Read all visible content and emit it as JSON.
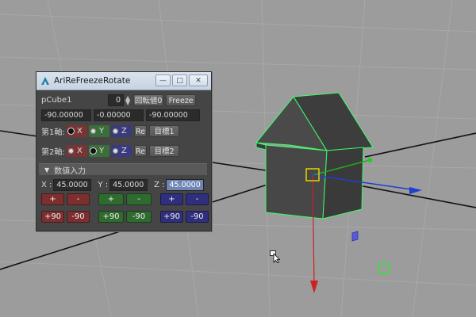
{
  "window": {
    "title": "AriReFreezeRotate",
    "controls": {
      "minimize": "—",
      "maximize": "□",
      "close": "✕"
    }
  },
  "object": {
    "name": "pCube1",
    "spin_value": "0",
    "reset_button": "回転値0",
    "freeze_button": "Freeze",
    "rot_x": "-90.00000",
    "rot_y": "-0.00000",
    "rot_z": "-90.00000"
  },
  "axis1": {
    "label": "第1軸:",
    "x": "X",
    "y": "Y",
    "z": "Z",
    "selected": "X",
    "re_button": "Re",
    "target_button": "目標1"
  },
  "axis2": {
    "label": "第2軸:",
    "x": "X",
    "y": "Y",
    "z": "Z",
    "selected": "Y",
    "re_button": "Re",
    "target_button": "目標2"
  },
  "numeric": {
    "header": "数値入力",
    "x_label": "X :",
    "x_value": "45.0000",
    "y_label": "Y :",
    "y_value": "45.0000",
    "z_label": "Z :",
    "z_value": "45.0000",
    "plus": "+",
    "minus": "-",
    "plus90": "+90",
    "minus90": "-90"
  },
  "colors": {
    "x_axis": "#cc2222",
    "y_axis": "#22aa22",
    "z_axis": "#1f3fd0",
    "selection_outline": "#3cff6a",
    "manipulator_center": "#e8d000"
  }
}
